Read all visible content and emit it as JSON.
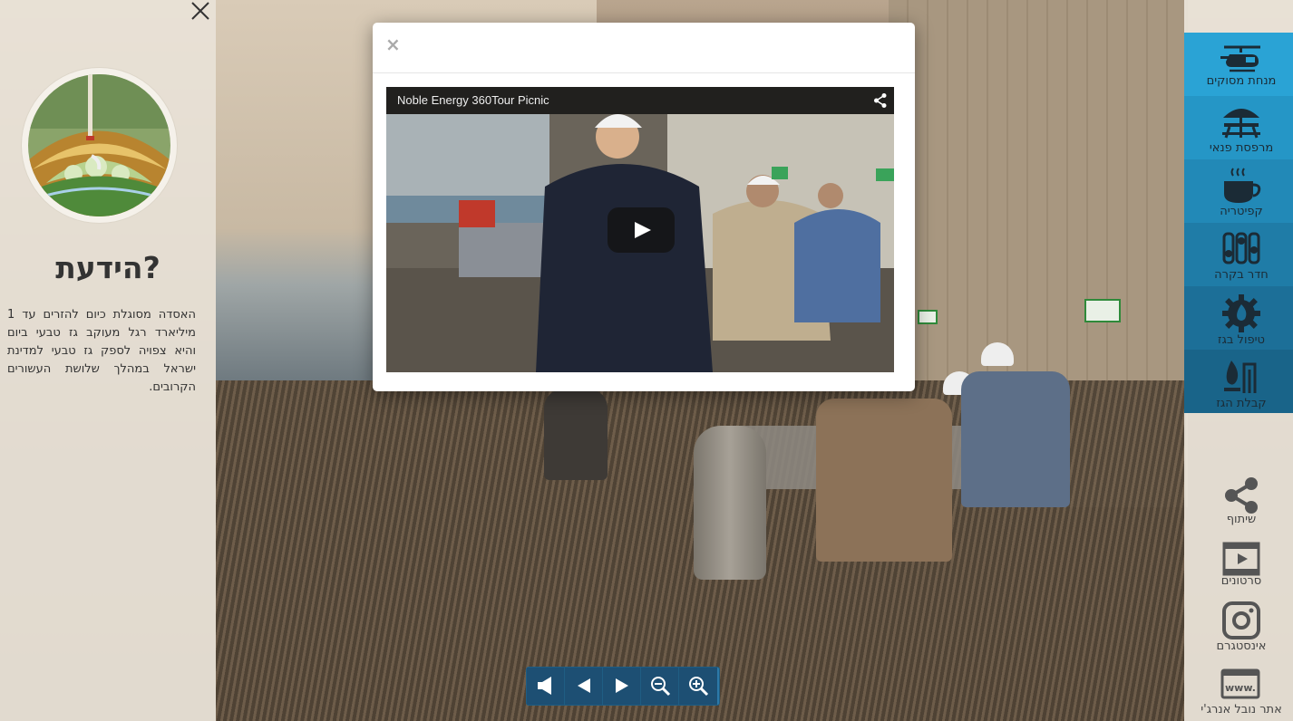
{
  "left_panel": {
    "close_label": "×",
    "heading": "הידעת?",
    "fact": "האסדה מסוגלת כיום להזרים עד 1 מיליארד רגל מעוקב גז טבעי ביום והיא צפויה לספק גז טבעי למדינת ישראל במהלך שלושת העשורים הקרובים."
  },
  "modal": {
    "close_label": "×",
    "video": {
      "title": "Noble Energy 360Tour Picnic"
    }
  },
  "right_nav": {
    "sections": [
      {
        "label": "מנחת מסוקים",
        "icon": "helicopter-icon",
        "color": "#2aa3d5"
      },
      {
        "label": "מרפסת פנאי",
        "icon": "picnic-table-icon",
        "color": "#2596c6"
      },
      {
        "label": "קפיטריה",
        "icon": "coffee-cup-icon",
        "color": "#2289b7"
      },
      {
        "label": "חדר בקרה",
        "icon": "sliders-icon",
        "color": "#1f7ca7"
      },
      {
        "label": "טיפול בגז",
        "icon": "gear-flame-icon",
        "color": "#1c6f98"
      },
      {
        "label": "קבלת הגז",
        "icon": "pipes-flame-icon",
        "color": "#196489"
      }
    ],
    "utilities": [
      {
        "label": "שיתוף",
        "icon": "share-icon"
      },
      {
        "label": "סרטונים",
        "icon": "film-icon"
      },
      {
        "label": "אינסטגרם",
        "icon": "instagram-icon"
      },
      {
        "label": "אתר נובל אנרג'י",
        "icon": "www-icon"
      }
    ]
  },
  "toolbar": {
    "buttons": [
      {
        "icon": "sound-icon"
      },
      {
        "icon": "arrow-left-icon"
      },
      {
        "icon": "arrow-right-icon"
      },
      {
        "icon": "zoom-out-icon"
      },
      {
        "icon": "zoom-in-icon"
      }
    ]
  }
}
